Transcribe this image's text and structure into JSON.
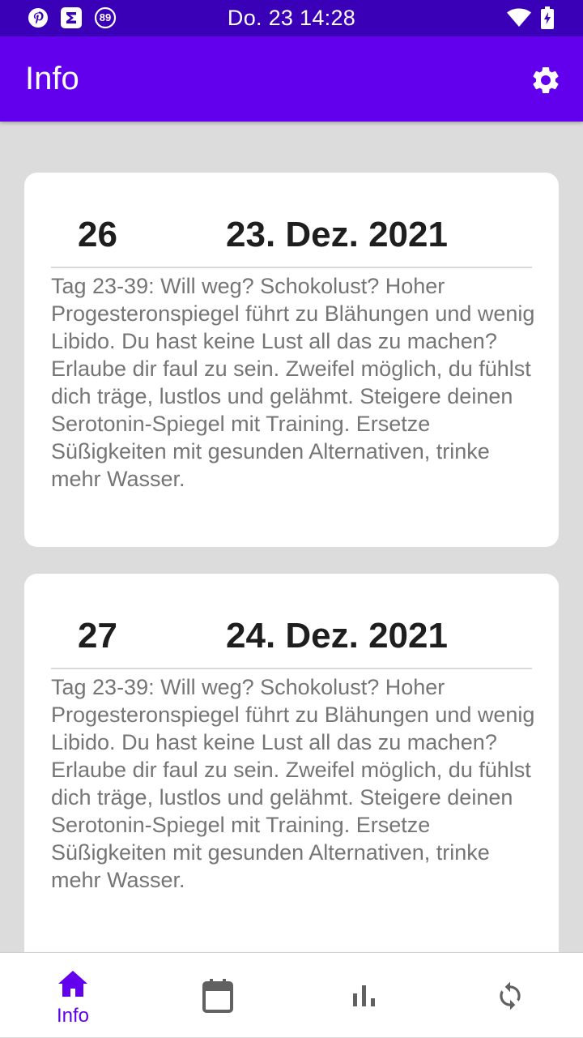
{
  "status_bar": {
    "time": "Do. 23 14:28",
    "badge_count": "89"
  },
  "app_bar": {
    "title": "Info"
  },
  "cards": [
    {
      "day": "26",
      "date": "23. Dez. 2021",
      "text": "Tag 23-39: Will weg? Schokolust? Hoher Progesteronspiegel führt zu Blähungen und wenig Libido. Du hast keine Lust all das zu machen? Erlaube dir faul zu sein. Zweifel möglich, du fühlst dich träge, lustlos und gelähmt. Steigere deinen Serotonin-Spiegel mit Training. Ersetze Süßigkeiten mit gesunden Alternativen, trinke mehr Wasser."
    },
    {
      "day": "27",
      "date": "24. Dez. 2021",
      "text": "Tag 23-39: Will weg? Schokolust? Hoher Progesteronspiegel führt zu Blähungen und wenig Libido. Du hast keine Lust all das zu machen? Erlaube dir faul zu sein. Zweifel möglich, du fühlst dich träge, lustlos und gelähmt. Steigere deinen Serotonin-Spiegel mit Training. Ersetze Süßigkeiten mit gesunden Alternativen, trinke mehr Wasser."
    }
  ],
  "bottom_nav": {
    "items": [
      {
        "label": "Info",
        "icon": "home-icon",
        "active": true
      },
      {
        "label": "",
        "icon": "calendar-icon",
        "active": false
      },
      {
        "label": "",
        "icon": "bar-chart-icon",
        "active": false
      },
      {
        "label": "",
        "icon": "sync-icon",
        "active": false
      }
    ]
  },
  "colors": {
    "status_bar": "#3a00b8",
    "primary": "#6200ee",
    "background": "#dcdcdc",
    "nav_inactive": "#616161"
  }
}
